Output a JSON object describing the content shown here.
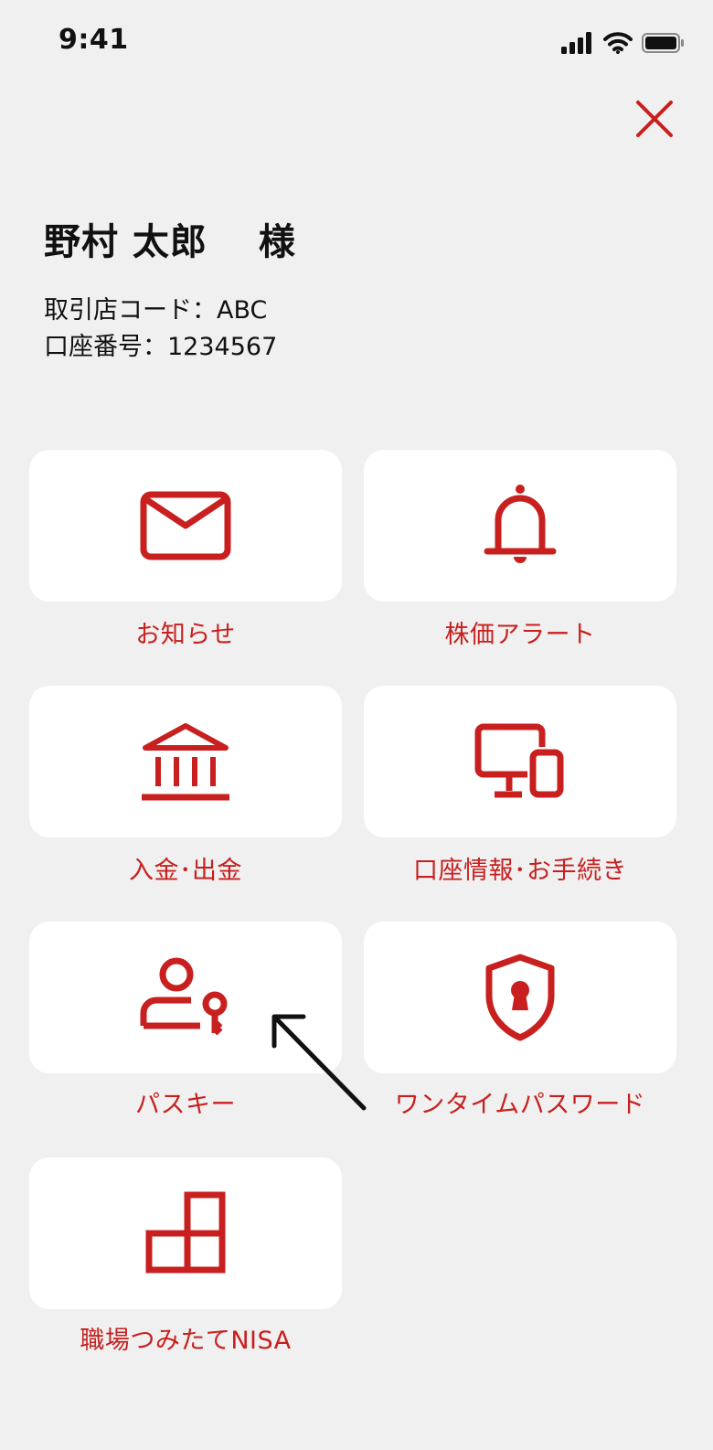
{
  "status_bar": {
    "time": "9:41"
  },
  "user": {
    "name": "野村 太郎　 様"
  },
  "account": {
    "branch_code": "取引店コード：ABC",
    "account_number": "口座番号：1234567"
  },
  "menu": {
    "items": [
      {
        "label": "お知らせ",
        "icon": "mail-icon"
      },
      {
        "label": "株価アラート",
        "icon": "bell-icon"
      },
      {
        "label": "入金･出金",
        "icon": "bank-icon"
      },
      {
        "label": "口座情報･お手続き",
        "icon": "devices-icon"
      },
      {
        "label": "パスキー",
        "icon": "user-key-icon"
      },
      {
        "label": "ワンタイムパスワード",
        "icon": "shield-keyhole-icon"
      },
      {
        "label": "職場つみたてNISA",
        "icon": "blocks-icon"
      }
    ]
  },
  "colors": {
    "accent": "#c7201f",
    "background": "#f0f0f0",
    "tile": "#ffffff"
  }
}
